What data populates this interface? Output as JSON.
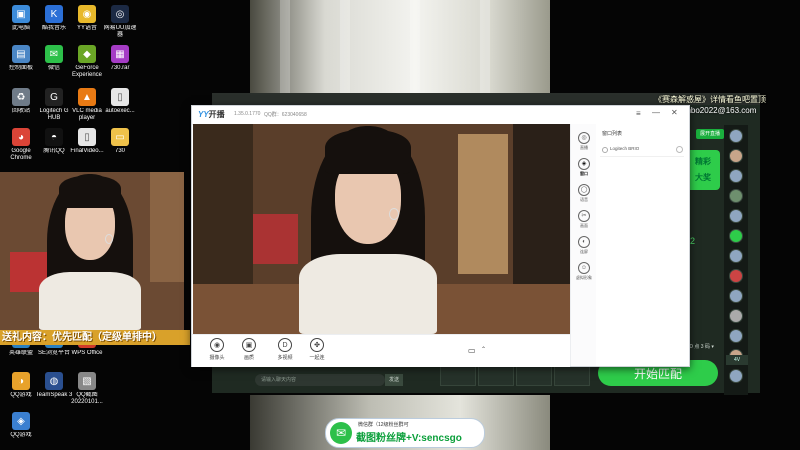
{
  "desktop": {
    "icons": [
      {
        "label": "此电脑",
        "icon": "computer-icon",
        "color": "#3c8bd9",
        "glyph": "▣"
      },
      {
        "label": "酷我音乐",
        "icon": "kuwo-icon",
        "color": "#2b6fd6",
        "glyph": "K"
      },
      {
        "label": "YY语音",
        "icon": "yy-icon",
        "color": "#e8b92b",
        "glyph": "◉"
      },
      {
        "label": "网易UU加速器",
        "icon": "uu-icon",
        "color": "#1c2a44",
        "glyph": "◎"
      },
      {
        "label": "控制面板",
        "icon": "control-panel-icon",
        "color": "#4a86c5",
        "glyph": "▤"
      },
      {
        "label": "微信",
        "icon": "wechat-icon",
        "color": "#2dc04a",
        "glyph": "✉"
      },
      {
        "label": "GeForce Experience",
        "icon": "geforce-icon",
        "color": "#6aa626",
        "glyph": "◆"
      },
      {
        "label": "730.rar",
        "icon": "rar-icon",
        "color": "#a53cc5",
        "glyph": "▦"
      },
      {
        "label": "回收站",
        "icon": "recycle-bin-icon",
        "color": "#6f7b88",
        "glyph": "♻"
      },
      {
        "label": "Logitech G HUB",
        "icon": "ghub-icon",
        "color": "#222222",
        "glyph": "G"
      },
      {
        "label": "VLC media player",
        "icon": "vlc-icon",
        "color": "#e87a14",
        "glyph": "▲"
      },
      {
        "label": "autoexec...",
        "icon": "file-icon",
        "color": "#e6e6e6",
        "glyph": "▯"
      },
      {
        "label": "Google Chrome",
        "icon": "chrome-icon",
        "color": "#db4437",
        "glyph": "◕"
      },
      {
        "label": "腾讯QQ",
        "icon": "qq-icon",
        "color": "#111111",
        "glyph": "◓"
      },
      {
        "label": "FinalVideo...",
        "icon": "document-icon",
        "color": "#e6e6e6",
        "glyph": "▯"
      },
      {
        "label": "730",
        "icon": "folder-icon",
        "color": "#f0c24a",
        "glyph": "▭"
      },
      {
        "label": "英雄联盟",
        "icon": "lol-icon",
        "color": "#2a7fbf",
        "glyph": "◒"
      },
      {
        "label": "SE浏览平台",
        "icon": "se-icon",
        "color": "#2a7fbf",
        "glyph": "◐"
      },
      {
        "label": "WPS Office",
        "icon": "wps-icon",
        "color": "#d03a2a",
        "glyph": "W"
      },
      {
        "label": "QQ游戏",
        "icon": "qq-game-icon",
        "color": "#e8a22b",
        "glyph": "◑"
      },
      {
        "label": "TeamSpeak 3",
        "icon": "teamspeak-icon",
        "color": "#2a4f8f",
        "glyph": "◍"
      },
      {
        "label": "QQ截图20220101...",
        "icon": "screenshot-icon",
        "color": "#888888",
        "glyph": "▧"
      },
      {
        "label": "QQ游戏",
        "icon": "qq-game2-icon",
        "color": "#3a7fd0",
        "glyph": "◈"
      }
    ]
  },
  "overlay": {
    "promo_line1": "《赛森解惑屋》详情看鱼吧置顶",
    "promo_line2": "邮箱：senbo2022@163.com",
    "left_caption": "送礼内容：优先匹配（定级单排中）",
    "wechat_small": "微信群（12级粉丝群可",
    "wechat_big": "截图粉丝牌+V:sencsgo"
  },
  "bg_client": {
    "open_live": "展开直播",
    "match_button": "开始匹配",
    "chat_placeholder": "请输入聊天内容",
    "send_label": "发送",
    "id_tag": "4V",
    "tiny_btn": "ID 点 3 码 ▾",
    "green_card_line1": "精彩",
    "green_card_line2": "大奖",
    "num": "12"
  },
  "yy": {
    "brand_prefix": "YY",
    "brand_suffix": "开播",
    "version": "1.35.0.1770",
    "qq": "QQ群：623040658",
    "menu_icon": "≡",
    "min_icon": "—",
    "close_icon": "✕",
    "tools": [
      {
        "label": "摄像头",
        "icon": "camera-tool-icon",
        "glyph": "◉"
      },
      {
        "label": "画质",
        "icon": "quality-icon",
        "glyph": "▣"
      },
      {
        "label": "多视频",
        "icon": "multi-video-icon",
        "glyph": "D"
      },
      {
        "label": "一起连",
        "icon": "connect-icon",
        "glyph": "✤"
      }
    ],
    "side_items": [
      {
        "label": "直播",
        "icon": "live-icon",
        "glyph": "◎"
      },
      {
        "label": "窗口",
        "icon": "window-icon",
        "glyph": "◈"
      },
      {
        "label": "语音",
        "icon": "voice-icon",
        "glyph": "◯"
      },
      {
        "label": "画面",
        "icon": "screen-icon",
        "glyph": "✂"
      },
      {
        "label": "连屏",
        "icon": "link-icon",
        "glyph": "◐"
      },
      {
        "label": "虚拟形象",
        "icon": "avatar-icon",
        "glyph": "☺"
      }
    ],
    "panel_title": "窗口列表",
    "panel_item": "Logitech BRIO"
  }
}
